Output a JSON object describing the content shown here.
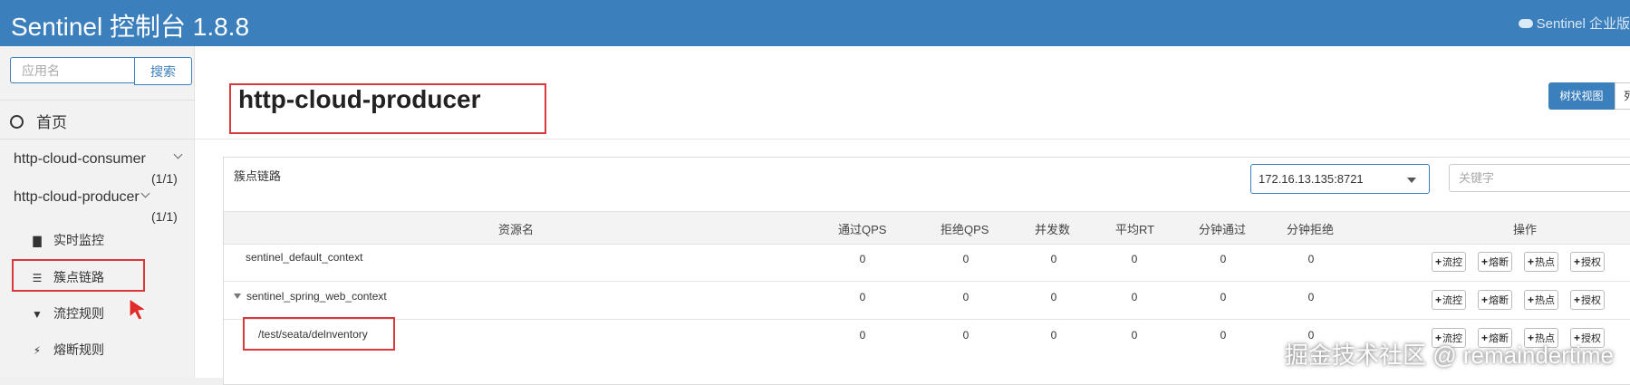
{
  "header": {
    "title": "Sentinel 控制台 1.8.8",
    "enterprise": "Sentinel 企业版"
  },
  "sidebar": {
    "search_placeholder": "应用名",
    "search_button": "搜索",
    "home": "首页",
    "apps": [
      {
        "name": "http-cloud-consumer",
        "count": "(1/1)"
      },
      {
        "name": "http-cloud-producer",
        "count": "(1/1)"
      }
    ],
    "menu": [
      "实时监控",
      "簇点链路",
      "流控规则",
      "熔断规则"
    ]
  },
  "main": {
    "app_title": "http-cloud-producer",
    "view_tree": "树状视图",
    "view_list": "列"
  },
  "panel": {
    "title": "簇点链路",
    "machine": "172.16.13.135:8721",
    "keyword_placeholder": "关键字",
    "columns": [
      "资源名",
      "通过QPS",
      "拒绝QPS",
      "并发数",
      "平均RT",
      "分钟通过",
      "分钟拒绝",
      "操作"
    ],
    "rows": [
      {
        "name": "sentinel_default_context",
        "values": [
          "0",
          "0",
          "0",
          "0",
          "0",
          "0"
        ]
      },
      {
        "name": "sentinel_spring_web_context",
        "values": [
          "0",
          "0",
          "0",
          "0",
          "0",
          "0"
        ]
      },
      {
        "name": "/test/seata/delnventory",
        "values": [
          "0",
          "0",
          "0",
          "0",
          "0",
          "0"
        ]
      }
    ],
    "actions": [
      "流控",
      "熔断",
      "热点",
      "授权"
    ]
  },
  "watermark": "掘金技术社区 @ remaindertime"
}
